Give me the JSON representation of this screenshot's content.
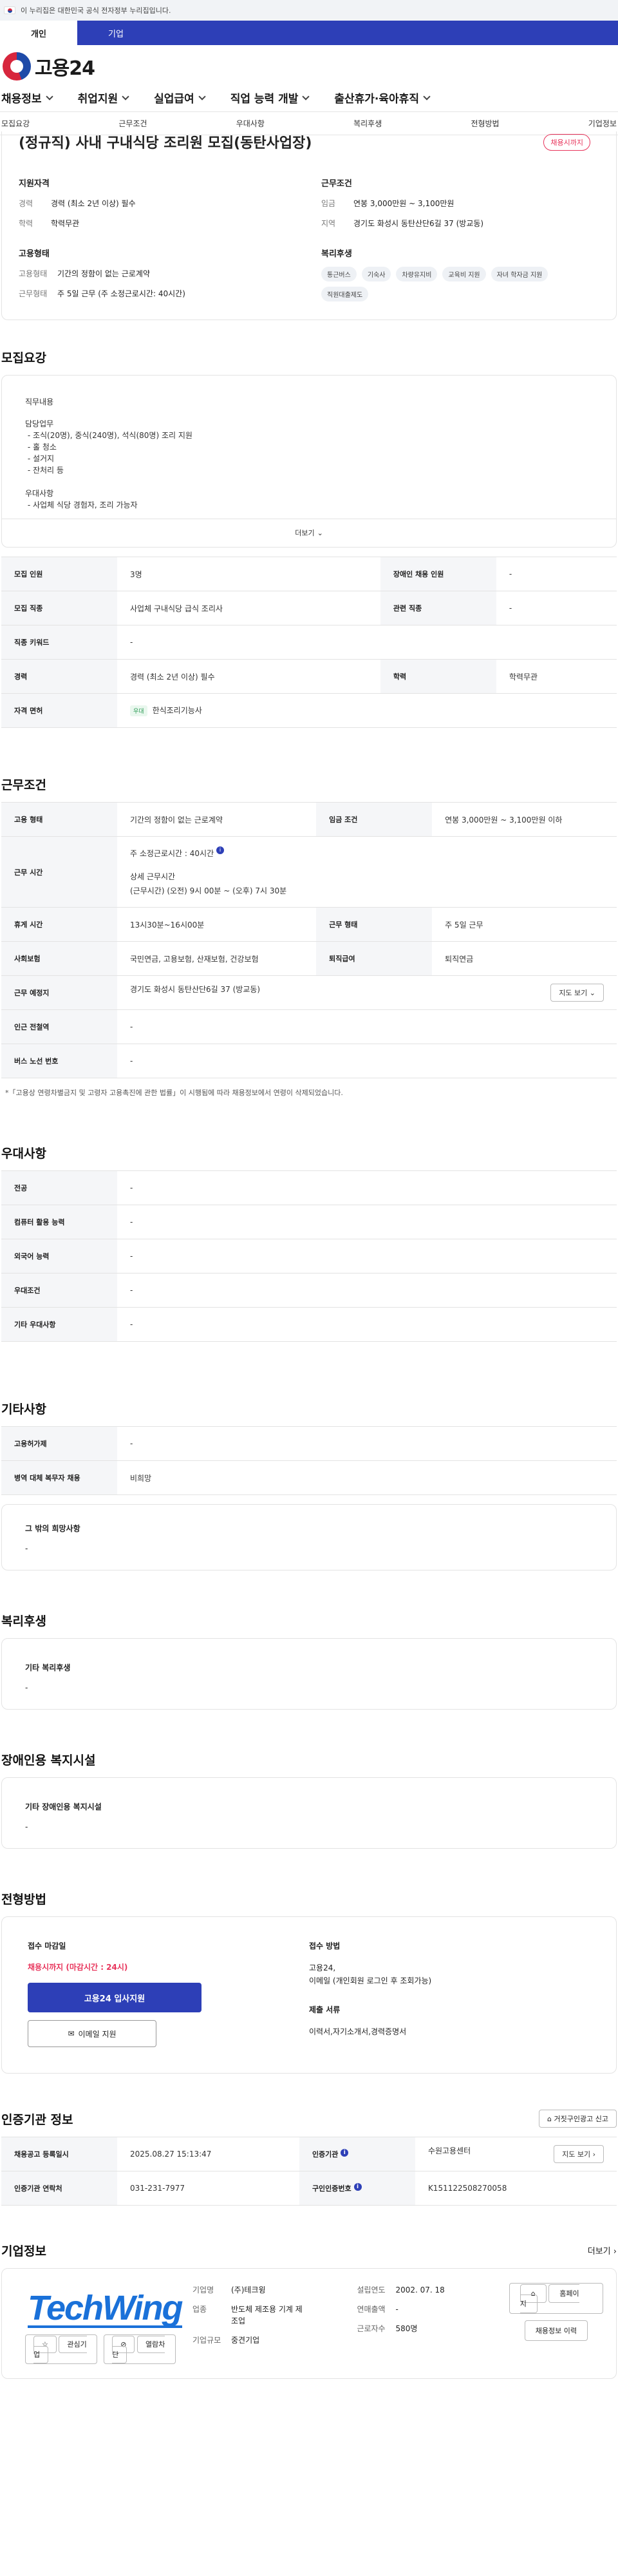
{
  "gov_banner": "이 누리집은 대한민국 공식 전자정부 누리집입니다.",
  "user_tabs": [
    "개인",
    "기업"
  ],
  "logo_text": "고용24",
  "gnb": [
    "채용정보",
    "취업지원",
    "실업급여",
    "직업 능력 개발",
    "출산휴가·육아휴직"
  ],
  "anchor_nav": [
    "모집요강",
    "근무조건",
    "우대사항",
    "복리후생",
    "전형방법",
    "기업정보"
  ],
  "summary": {
    "title": "(정규직) 사내 구내식당 조리원 모집(동탄사업장)",
    "deadline_badge": "채용시까지",
    "qual_title": "지원자격",
    "qual": [
      {
        "k": "경력",
        "v": "경력 (최소 2년 이상) 필수"
      },
      {
        "k": "학력",
        "v": "학력무관"
      }
    ],
    "cond_title": "근무조건",
    "cond": [
      {
        "k": "임금",
        "v": "연봉 3,000만원 ~ 3,100만원"
      },
      {
        "k": "지역",
        "v": "경기도 화성시 동탄산단6길 37 (방교동)"
      }
    ],
    "emp_title": "고용형태",
    "emp": [
      {
        "k": "고용형태",
        "v": "기간의 정함이 없는 근로계약"
      },
      {
        "k": "근무형태",
        "v": "주 5일 근무 (주 소정근로시간: 40시간)"
      }
    ],
    "welfare_title": "복리후생",
    "welfare_chips": [
      "통근버스",
      "기숙사",
      "차량유지비",
      "교육비 지원",
      "자녀 학자금 지원",
      "직원대출제도"
    ]
  },
  "recruit": {
    "title": "모집요강",
    "duty_label": "직무내용",
    "duty_text": "담당업무\n - 조식(20명), 중식(240명), 석식(80명) 조리 지원\n - 홀 청소\n - 설거지\n - 잔처리 등\n\n우대사항\n - 사업체 식당 경험자, 조리 가능자",
    "more": "더보기",
    "rows": [
      {
        "th1": "모집 인원",
        "td1": "3명",
        "th2": "장애인 채용 인원",
        "td2": "-"
      },
      {
        "th1": "모집 직종",
        "td1": "사업체 구내식당 급식 조리사",
        "th2": "관련 직종",
        "td2": "-"
      },
      {
        "th1": "직종 키워드",
        "td1": "-"
      },
      {
        "th1": "경력",
        "td1": "경력 (최소 2년 이상) 필수",
        "th2": "학력",
        "td2": "학력무관"
      },
      {
        "th1": "자격 면허",
        "td1_tag": "우대",
        "td1": "한식조리기능사"
      }
    ]
  },
  "work": {
    "title": "근무조건",
    "employment_th": "고용 형태",
    "employment": "기간의 정함이 없는 근로계약",
    "wage_th": "임금 조건",
    "wage": "연봉 3,000만원 ~ 3,100만원 이하",
    "hours_th": "근무 시간",
    "hours_main": "주 소정근로시간 : 40시간",
    "hours_detail_label": "상세 근무시간",
    "hours_detail": "(근무시간) (오전) 9시 00분 ~ (오후) 7시 30분",
    "break_th": "휴게 시간",
    "break": "13시30분~16시00분",
    "shift_th": "근무 형태",
    "shift": "주 5일 근무",
    "insurance_th": "사회보험",
    "insurance": "국민연금, 고용보험, 산재보험, 건강보험",
    "retire_th": "퇴직급여",
    "retire": "퇴직연금",
    "place_th": "근무 예정지",
    "place": "경기도 화성시 동탄산단6길 37 (방교동)",
    "map_btn": "지도 보기",
    "subway_th": "인근 전철역",
    "subway": "-",
    "bus_th": "버스 노선 번호",
    "bus": "-",
    "footnote": "*「고용상 연령차별금지 및 고령자 고용촉진에 관한 법률」이 시행됨에 따라 채용정보에서 연령이 삭제되었습니다."
  },
  "preference": {
    "title": "우대사항",
    "rows": [
      {
        "th": "전공",
        "td": "-"
      },
      {
        "th": "컴퓨터 활용 능력",
        "td": "-"
      },
      {
        "th": "외국어 능력",
        "td": "-"
      },
      {
        "th": "우대조건",
        "td": "-"
      },
      {
        "th": "기타 우대사항",
        "td": "-"
      }
    ]
  },
  "etc": {
    "title": "기타사항",
    "rows": [
      {
        "th": "고용허가제",
        "td": "-"
      },
      {
        "th": "병역 대체 복무자 채용",
        "td": "비희망"
      }
    ],
    "hope_title": "그 밖의 희망사항",
    "hope": "-"
  },
  "welfare": {
    "title": "복리후생",
    "sub": "기타 복리후생",
    "value": "-"
  },
  "disabled": {
    "title": "장애인용 복지시설",
    "sub": "기타 장애인용 복지시설",
    "value": "-"
  },
  "screening": {
    "title": "전형방법",
    "deadline_label": "접수 마감일",
    "deadline": "채용시까지 (마감시간 : 24시)",
    "apply_btn": "고용24 입사지원",
    "email_btn": "이메일 지원",
    "method_label": "접수 방법",
    "method": "고용24,\n이메일 (개인회원 로그인 후 조회가능)",
    "docs_label": "제출 서류",
    "docs": "이력서,자기소개서,경력증명서"
  },
  "cert": {
    "title": "인증기관 정보",
    "report_btn": "거짓구인광고 신고",
    "reg_th": "채용공고 등록일시",
    "reg": "2025.08.27 15:13:47",
    "agency_th": "인증기관",
    "agency": "수원고용센터",
    "map_btn": "지도 보기",
    "phone_th": "인증기관 연락처",
    "phone": "031-231-7977",
    "reg_no_th": "구인인증번호",
    "reg_no": "K151122508270058"
  },
  "company": {
    "title": "기업정보",
    "more": "더보기",
    "logo_text": "TechWing",
    "fav_btn": "관심기업",
    "block_btn": "열람차단",
    "name_k": "기업명",
    "name": "(주)테크윙",
    "biz_k": "업종",
    "biz": "반도체 제조용 기계 제조업",
    "scale_k": "기업규모",
    "scale": "중견기업",
    "year_k": "설립연도",
    "year": "2002. 07. 18",
    "sales_k": "연매출액",
    "sales": "-",
    "emp_k": "근로자수",
    "emp": "580명",
    "home_btn": "홈페이지",
    "list_btn": "채용정보 이력"
  }
}
